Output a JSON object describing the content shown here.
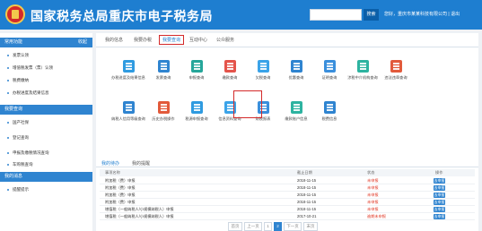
{
  "header": {
    "title": "国家税务总局重庆市电子税务局",
    "search_button": "搜索",
    "user_info": "您好，重庆市某某科技有限公司  |  退出"
  },
  "sidebar": {
    "sections": [
      {
        "label": "常用功能",
        "action": "收起",
        "items": [
          "发票认领",
          "增值税发票（票）认领",
          "税费缴纳",
          "办税进度及结果信息"
        ]
      },
      {
        "label": "我要查询",
        "items": [
          "国产社保",
          "登记查询",
          "申报及缴税情况查询",
          "车购税查询"
        ]
      },
      {
        "label": "我的消息",
        "items": [
          "提醒提示"
        ]
      }
    ]
  },
  "tabs": [
    "我的信息",
    "我要办税",
    "我要查询",
    "互动中心",
    "公众服务"
  ],
  "active_tab": "我要查询",
  "grid": {
    "row1": [
      "办税进度及结果信息",
      "发票查询",
      "申报查询",
      "缴款查询",
      "欠税查询",
      "优惠查询",
      "证明查询",
      "涉税中介机构查询",
      "违法违章查询"
    ],
    "row2": [
      "纳税人信用等级查询",
      "历史办税操作",
      "税源申报查询",
      "信息资料查询",
      "财税报表",
      "缴款账户信息",
      "税费信息"
    ]
  },
  "subtabs": [
    "我的待办",
    "我的提醒"
  ],
  "table": {
    "headers": [
      "事项名称",
      "截止日期",
      "状态",
      "操作"
    ],
    "rows": [
      {
        "name": "附加税（费）申报",
        "date": "2018-11-15",
        "status": "未申报",
        "op": "去申报"
      },
      {
        "name": "附加税（费）申报",
        "date": "2018-11-15",
        "status": "未申报",
        "op": "去申报"
      },
      {
        "name": "附加税（费）申报",
        "date": "2018-11-15",
        "status": "未申报",
        "op": "去申报"
      },
      {
        "name": "附加税（费）申报",
        "date": "2018-11-15",
        "status": "未申报",
        "op": "去申报"
      },
      {
        "name": "增值税（一般纳税人/小规模纳税人）申报",
        "date": "2018-11-15",
        "status": "未申报",
        "op": "去申报"
      },
      {
        "name": "增值税（一般纳税人/小规模纳税人）申报",
        "date": "2017-10-21",
        "status": "逾期未申报",
        "op": "去申报"
      }
    ]
  },
  "pager": {
    "first": "首页",
    "prev": "上一页",
    "pages": [
      "1",
      "2"
    ],
    "next": "下一页",
    "last": "末页",
    "current": "2"
  },
  "colors": {
    "header_blue": "#1e7ed0",
    "highlight_red": "#d42a2a"
  }
}
